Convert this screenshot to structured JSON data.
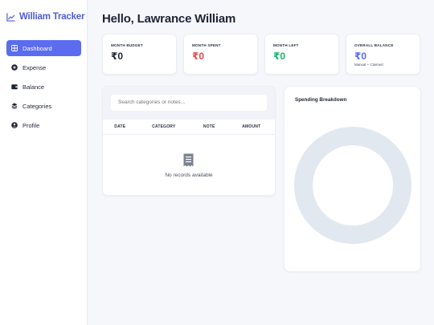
{
  "app": {
    "title": "William Tracker",
    "accent": "#5b6cf0"
  },
  "sidebar": {
    "items": [
      {
        "label": "Dashboard",
        "icon": "grid-icon",
        "active": true
      },
      {
        "label": "Expense",
        "icon": "plus-circle-icon",
        "active": false
      },
      {
        "label": "Balance",
        "icon": "wallet-icon",
        "active": false
      },
      {
        "label": "Categories",
        "icon": "layers-icon",
        "active": false
      },
      {
        "label": "Profile",
        "icon": "user-circle-icon",
        "active": false
      }
    ]
  },
  "header": {
    "greeting": "Hello, Lawrance William"
  },
  "summary": [
    {
      "label": "MONTH BUDGET",
      "value": "₹0",
      "color": "#1e2433"
    },
    {
      "label": "MONTH SPENT",
      "value": "₹0",
      "color": "#e5484d"
    },
    {
      "label": "MONTH LEFT",
      "value": "₹0",
      "color": "#17b26a"
    },
    {
      "label": "OVERALL BALANCE",
      "value": "₹0",
      "color": "#5b6cf0",
      "sub": "Manual + Claimed"
    }
  ],
  "records": {
    "search_placeholder": "Search categories or notes...",
    "columns": [
      "DATE",
      "CATEGORY",
      "NOTE",
      "AMOUNT"
    ],
    "empty_icon": "receipt-icon",
    "empty_text": "No records available"
  },
  "spending": {
    "title": "Spending Breakdown",
    "ring_color": "#e2e8f0"
  }
}
